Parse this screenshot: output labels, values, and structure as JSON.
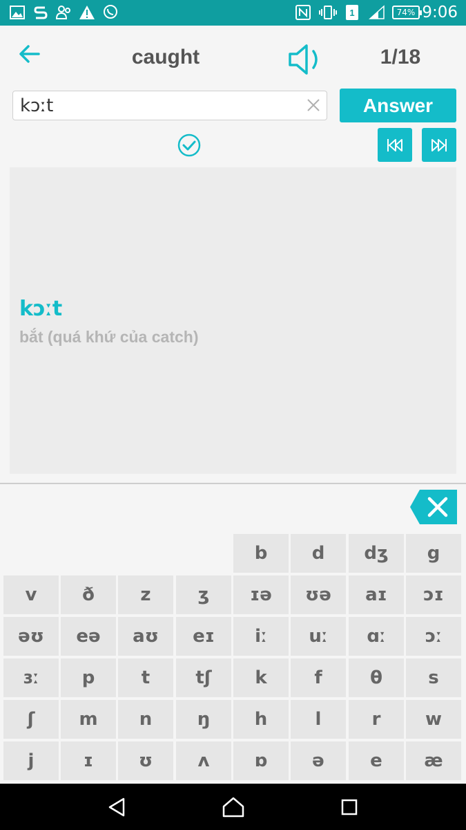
{
  "status_bar": {
    "time": "9:06",
    "battery": "74%",
    "sim": "1",
    "icons": [
      "image-icon",
      "s-app-icon",
      "people-icon",
      "warning-icon",
      "viber-icon",
      "nfc-icon",
      "vibrate-icon",
      "signal-icon",
      "battery-icon"
    ]
  },
  "header": {
    "title": "caught",
    "counter": "1/18",
    "accent_color": "#14bcc9"
  },
  "answer_field": {
    "value": "kɔːt",
    "button_label": "Answer"
  },
  "card": {
    "ipa": "kɔːt",
    "meaning": "bắt (quá khứ của catch)"
  },
  "keyboard": {
    "rows": [
      [
        "b",
        "d",
        "dʒ",
        "g"
      ],
      [
        "v",
        "ð",
        "z",
        "ʒ",
        "ɪə",
        "ʊə",
        "aɪ",
        "ɔɪ"
      ],
      [
        "əʊ",
        "eə",
        "aʊ",
        "eɪ",
        "iː",
        "uː",
        "ɑː",
        "ɔː"
      ],
      [
        "ɜː",
        "p",
        "t",
        "tʃ",
        "k",
        "f",
        "θ",
        "s"
      ],
      [
        "ʃ",
        "m",
        "n",
        "ŋ",
        "h",
        "l",
        "r",
        "w"
      ],
      [
        "j",
        "ɪ",
        "ʊ",
        "ʌ",
        "ɒ",
        "ə",
        "e",
        "æ"
      ]
    ]
  }
}
